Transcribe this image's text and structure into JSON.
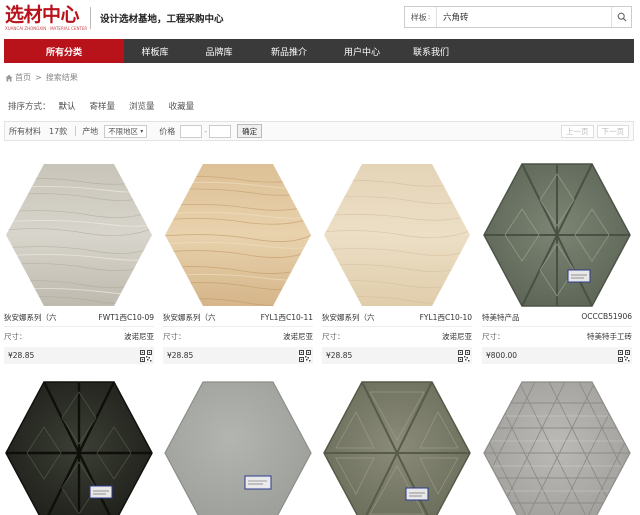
{
  "header": {
    "logo_main": "选材中心",
    "logo_sub": "XUANCAI ZHONGXIN · MATERIAL CENTER",
    "slogan": "设计选材基地，工程采购中心",
    "search": {
      "category": "样板",
      "value": "六角砖"
    }
  },
  "nav": {
    "items": [
      {
        "label": "所有分类"
      },
      {
        "label": "样板库"
      },
      {
        "label": "品牌库"
      },
      {
        "label": "新品推介"
      },
      {
        "label": "用户中心"
      },
      {
        "label": "联系我们"
      }
    ]
  },
  "breadcrumb": {
    "home": "首页",
    "sep": ">",
    "current": "搜索结果"
  },
  "sort": {
    "label": "排序方式：",
    "options": [
      {
        "label": "默认"
      },
      {
        "label": "寄样量"
      },
      {
        "label": "浏览量"
      },
      {
        "label": "收藏量"
      }
    ]
  },
  "filter": {
    "all_label": "所有材料",
    "count": "17款",
    "origin_label": "产地",
    "region": "不限地区",
    "price_label": "价格",
    "price_dash": "-",
    "confirm": "确定",
    "prev": "上一页",
    "next": "下一页"
  },
  "products": [
    {
      "name": "狄安娜系列（六",
      "code": "FWT1西C10-09",
      "size_label": "尺寸：",
      "brand": "波诺尼亚",
      "price": "¥28.85",
      "tile": "wood-grey"
    },
    {
      "name": "狄安娜系列（六",
      "code": "FYL1西C10-11",
      "size_label": "尺寸：",
      "brand": "波诺尼亚",
      "price": "¥28.85",
      "tile": "wood-oak"
    },
    {
      "name": "狄安娜系列（六",
      "code": "FYL1西C10-10",
      "size_label": "尺寸：",
      "brand": "波诺尼亚",
      "price": "¥28.85",
      "tile": "wood-light"
    },
    {
      "name": "特美特产品",
      "code": "OCCCB51906",
      "size_label": "尺寸：",
      "brand": "特美特手工砖",
      "price": "¥800.00",
      "tile": "cube-sage"
    },
    {
      "tile": "cube-black"
    },
    {
      "tile": "plain-grey"
    },
    {
      "tile": "triangle-olive"
    },
    {
      "tile": "triangle-grey"
    }
  ],
  "colors": {
    "brand_red": "#b8131b",
    "nav_bg": "#3a3a3a"
  }
}
